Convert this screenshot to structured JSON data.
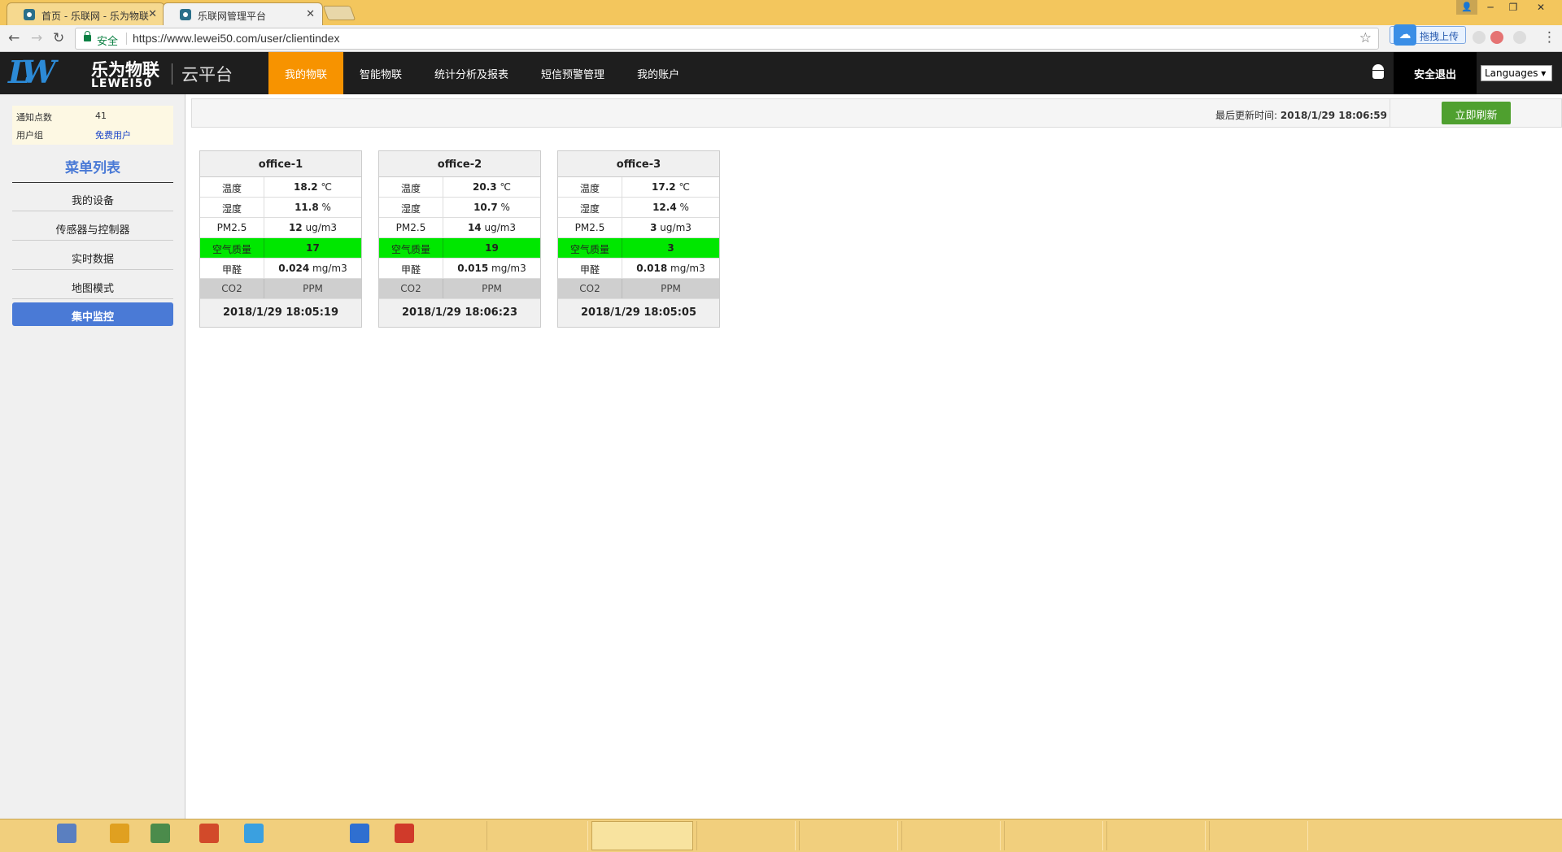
{
  "browser": {
    "tabs": [
      {
        "label": "首页 - 乐联网 - 乐为物联",
        "active": false
      },
      {
        "label": "乐联网管理平台",
        "active": true
      }
    ],
    "secure_label": "安全",
    "url": "https://www.lewei50.com/user/clientindex",
    "extension_upload_label": "拖拽上传"
  },
  "header": {
    "logo_cn": "乐为物联",
    "logo_en": "LEWEI50",
    "platform": "云平台",
    "nav": [
      {
        "label": "我的物联",
        "active": true
      },
      {
        "label": "智能物联",
        "active": false
      },
      {
        "label": "统计分析及报表",
        "active": false
      },
      {
        "label": "短信预警管理",
        "active": false
      },
      {
        "label": "我的账户",
        "active": false
      }
    ],
    "logout_label": "安全退出",
    "languages_label": "Languages ▾"
  },
  "sidebar": {
    "info": [
      {
        "key": "通知点数",
        "value": "41"
      },
      {
        "key": "用户组",
        "value": "免费用户"
      }
    ],
    "menu_title": "菜单列表",
    "menu": [
      {
        "label": "我的设备",
        "active": false
      },
      {
        "label": "传感器与控制器",
        "active": false
      },
      {
        "label": "实时数据",
        "active": false
      },
      {
        "label": "地图模式",
        "active": false
      },
      {
        "label": "集中监控",
        "active": true
      }
    ]
  },
  "main": {
    "last_updated_label": "最后更新时间:",
    "last_updated_value": "2018/1/29 18:06:59",
    "refresh_label": "立即刷新",
    "devices": [
      {
        "name": "office-1",
        "rows": [
          {
            "label": "温度",
            "value": "18.2",
            "unit": "℃"
          },
          {
            "label": "湿度",
            "value": "11.8",
            "unit": "%"
          },
          {
            "label": "PM2.5",
            "value": "12",
            "unit": "ug/m3"
          },
          {
            "label": "空气质量",
            "value": "17",
            "unit": ""
          },
          {
            "label": "甲醛",
            "value": "0.024",
            "unit": "mg/m3"
          },
          {
            "label": "CO2",
            "value": "",
            "unit": "PPM"
          }
        ],
        "time": "2018/1/29 18:05:19"
      },
      {
        "name": "office-2",
        "rows": [
          {
            "label": "温度",
            "value": "20.3",
            "unit": "℃"
          },
          {
            "label": "湿度",
            "value": "10.7",
            "unit": "%"
          },
          {
            "label": "PM2.5",
            "value": "14",
            "unit": "ug/m3"
          },
          {
            "label": "空气质量",
            "value": "19",
            "unit": ""
          },
          {
            "label": "甲醛",
            "value": "0.015",
            "unit": "mg/m3"
          },
          {
            "label": "CO2",
            "value": "",
            "unit": "PPM"
          }
        ],
        "time": "2018/1/29 18:06:23"
      },
      {
        "name": "office-3",
        "rows": [
          {
            "label": "温度",
            "value": "17.2",
            "unit": "℃"
          },
          {
            "label": "湿度",
            "value": "12.4",
            "unit": "%"
          },
          {
            "label": "PM2.5",
            "value": "3",
            "unit": "ug/m3"
          },
          {
            "label": "空气质量",
            "value": "3",
            "unit": ""
          },
          {
            "label": "甲醛",
            "value": "0.018",
            "unit": "mg/m3"
          },
          {
            "label": "CO2",
            "value": "",
            "unit": "PPM"
          }
        ],
        "time": "2018/1/29 18:05:05"
      }
    ]
  },
  "colors": {
    "nav_active": "#f79300",
    "menu_active": "#4a7ad6",
    "air_quality_good": "#00e700",
    "refresh_button": "#4fa02f"
  }
}
